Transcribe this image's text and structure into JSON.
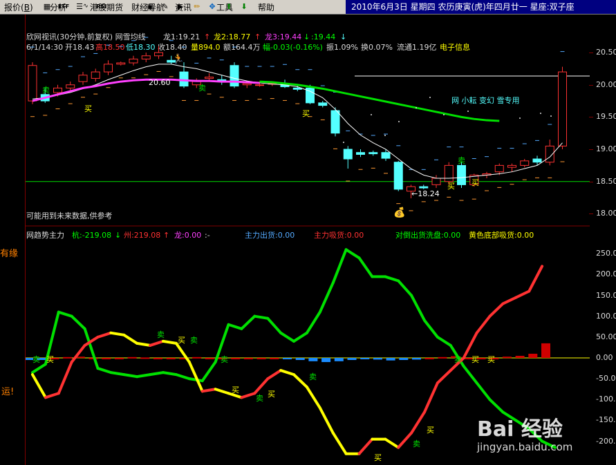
{
  "menu": {
    "items": [
      {
        "label": "报价",
        "key": "B"
      },
      {
        "label": "分析"
      },
      {
        "label": "港股期货"
      },
      {
        "label": "财经导航"
      },
      {
        "label": "资讯"
      },
      {
        "label": "工具"
      },
      {
        "label": "帮助"
      }
    ],
    "ind_labels": [
      "ETF",
      "RSI"
    ]
  },
  "date_info": "2010年6月3日  星期四  农历庚寅(虎)年四月廿一    星座:双子座",
  "left_labels": [
    "有缘",
    "运!"
  ],
  "top_panel": {
    "title": "欣网视讯(30分钟,前复权) 网雪均线",
    "long1": "龙1:19.21",
    "long2": "龙2:18.77",
    "long3": "龙3:19.44",
    "val4": ":19.44",
    "info": {
      "time": "6/1/14:30",
      "open": "开18.43",
      "high": "高18.50",
      "low": "低18.30",
      "close": "收18.40",
      "volume": "量894.0",
      "amount": "额164.4万",
      "change": "幅-0.03(-0.16%)",
      "amplitude": "振1.09%",
      "turnover": "换0.07%",
      "float": "流通1.19亿",
      "sector": "电子信息"
    },
    "annotation": "网 小耘 变幻 雪专用",
    "note": "可能用到未来数据,供参考",
    "max_label": "20.60",
    "min_label": "18.24",
    "sell_label": "卖",
    "buy_label": "买",
    "y_ticks": [
      "20.50",
      "20.00",
      "19.50",
      "19.00",
      "18.50",
      "18.00"
    ]
  },
  "bottom_panel": {
    "title": "网趋势主力",
    "hang": "杭:-219.08",
    "zhou": "州:219.08",
    "long": "龙:0.00",
    "main_out": "主力出货:0.00",
    "main_in": "主力吸货:0.00",
    "hedge": "对倒出货洗盘:0.00",
    "yellow": "黄色底部吸货:0.00",
    "y_ticks": [
      "250.00",
      "200.00",
      "150.00",
      "100.00",
      "50.00",
      "0.00",
      "-50.00",
      "-100.00",
      "-150.00",
      "-200.00"
    ]
  },
  "colors": {
    "up": "#ff3232",
    "down": "#54ffff",
    "green": "#00e000",
    "magenta": "#ff40ff",
    "yellow": "#ffff00",
    "axis": "#800000"
  },
  "watermark": {
    "brand": "Bai 经验",
    "url": "jingyan.baidu.com"
  },
  "chart_data": [
    {
      "type": "candlestick",
      "title": "欣网视讯(30分钟,前复权)",
      "ylim": [
        17.8,
        20.8
      ],
      "candles": [
        {
          "o": 19.75,
          "h": 20.35,
          "l": 19.7,
          "c": 20.3
        },
        {
          "o": 19.85,
          "h": 19.95,
          "l": 19.72,
          "c": 19.75
        },
        {
          "o": 19.88,
          "h": 20.0,
          "l": 19.82,
          "c": 19.95
        },
        {
          "o": 19.95,
          "h": 20.05,
          "l": 19.9,
          "c": 20.0
        },
        {
          "o": 20.05,
          "h": 20.2,
          "l": 20.0,
          "c": 20.15
        },
        {
          "o": 20.1,
          "h": 20.25,
          "l": 20.05,
          "c": 20.2
        },
        {
          "o": 20.2,
          "h": 20.38,
          "l": 20.15,
          "c": 20.32
        },
        {
          "o": 20.32,
          "h": 20.36,
          "l": 20.3,
          "c": 20.34
        },
        {
          "o": 20.34,
          "h": 20.45,
          "l": 20.3,
          "c": 20.4
        },
        {
          "o": 20.4,
          "h": 20.5,
          "l": 20.35,
          "c": 20.45
        },
        {
          "o": 20.45,
          "h": 20.6,
          "l": 20.4,
          "c": 20.5
        },
        {
          "o": 20.38,
          "h": 20.45,
          "l": 20.32,
          "c": 20.35
        },
        {
          "o": 20.2,
          "h": 20.35,
          "l": 19.95,
          "c": 19.98
        },
        {
          "o": 20.0,
          "h": 20.1,
          "l": 19.95,
          "c": 20.05
        },
        {
          "o": 20.1,
          "h": 20.18,
          "l": 20.05,
          "c": 20.12
        },
        {
          "o": 20.08,
          "h": 20.15,
          "l": 20.0,
          "c": 20.05
        },
        {
          "o": 20.3,
          "h": 20.35,
          "l": 19.95,
          "c": 19.98
        },
        {
          "o": 20.0,
          "h": 20.05,
          "l": 19.95,
          "c": 20.02
        },
        {
          "o": 20.0,
          "h": 20.05,
          "l": 19.97,
          "c": 20.0
        },
        {
          "o": 20.02,
          "h": 20.05,
          "l": 19.98,
          "c": 20.02
        },
        {
          "o": 20.02,
          "h": 20.08,
          "l": 19.95,
          "c": 19.97
        },
        {
          "o": 19.95,
          "h": 20.0,
          "l": 19.9,
          "c": 19.93
        },
        {
          "o": 19.95,
          "h": 20.0,
          "l": 19.7,
          "c": 19.72
        },
        {
          "o": 19.72,
          "h": 19.75,
          "l": 19.65,
          "c": 19.68
        },
        {
          "o": 19.6,
          "h": 19.65,
          "l": 19.2,
          "c": 19.25
        },
        {
          "o": 19.0,
          "h": 19.05,
          "l": 18.7,
          "c": 18.85
        },
        {
          "o": 18.95,
          "h": 19.0,
          "l": 18.88,
          "c": 18.92
        },
        {
          "o": 18.95,
          "h": 18.98,
          "l": 18.9,
          "c": 18.93
        },
        {
          "o": 18.95,
          "h": 19.0,
          "l": 18.82,
          "c": 18.86
        },
        {
          "o": 18.8,
          "h": 18.82,
          "l": 18.35,
          "c": 18.38
        },
        {
          "o": 18.35,
          "h": 18.45,
          "l": 18.24,
          "c": 18.42
        },
        {
          "o": 18.42,
          "h": 18.45,
          "l": 18.38,
          "c": 18.4
        },
        {
          "o": 18.45,
          "h": 18.6,
          "l": 18.4,
          "c": 18.55
        },
        {
          "o": 18.5,
          "h": 18.8,
          "l": 18.45,
          "c": 18.75
        },
        {
          "o": 18.75,
          "h": 18.8,
          "l": 18.4,
          "c": 18.45
        },
        {
          "o": 18.45,
          "h": 18.62,
          "l": 18.42,
          "c": 18.6
        },
        {
          "o": 18.6,
          "h": 18.65,
          "l": 18.55,
          "c": 18.62
        },
        {
          "o": 18.65,
          "h": 18.78,
          "l": 18.6,
          "c": 18.75
        },
        {
          "o": 18.72,
          "h": 18.78,
          "l": 18.65,
          "c": 18.75
        },
        {
          "o": 18.75,
          "h": 18.85,
          "l": 18.72,
          "c": 18.82
        },
        {
          "o": 18.85,
          "h": 18.9,
          "l": 18.75,
          "c": 18.8
        },
        {
          "o": 18.8,
          "h": 19.15,
          "l": 18.75,
          "c": 19.05
        },
        {
          "o": 19.05,
          "h": 20.28,
          "l": 19.0,
          "c": 20.2
        }
      ],
      "ma_white": [
        19.78,
        19.8,
        19.84,
        19.88,
        19.94,
        20.0,
        20.08,
        20.15,
        20.22,
        20.28,
        20.32,
        20.32,
        20.28,
        20.25,
        20.2,
        20.15,
        20.1,
        20.06,
        20.03,
        20.01,
        20.0,
        19.97,
        19.9,
        19.8,
        19.62,
        19.4,
        19.22,
        19.1,
        19.0,
        18.85,
        18.7,
        18.6,
        18.55,
        18.55,
        18.56,
        18.58,
        18.6,
        18.62,
        18.65,
        18.7,
        18.75,
        18.88,
        19.1
      ],
      "ma_magenta": [
        19.75,
        19.8,
        19.85,
        19.9,
        19.95,
        19.98,
        20.02,
        20.05,
        20.07,
        20.08,
        20.08,
        20.08,
        20.07,
        20.06,
        20.06,
        20.05,
        20.05,
        20.04,
        20.03
      ],
      "ma_green": [
        20.05,
        20.04,
        20.02,
        20.0,
        19.97,
        19.94,
        19.9,
        19.86,
        19.82,
        19.78,
        19.74,
        19.7,
        19.66,
        19.62,
        19.58,
        19.54,
        19.5,
        19.47,
        19.45,
        19.44
      ],
      "hline": 18.5
    },
    {
      "type": "line",
      "title": "网趋势主力",
      "ylim": [
        -215,
        270
      ],
      "series": [
        {
          "name": "杭",
          "values": [
            -35,
            -15,
            110,
            100,
            70,
            -25,
            -35,
            -40,
            -45,
            -40,
            -35,
            -40,
            -50,
            -55,
            -10,
            80,
            70,
            100,
            95,
            60,
            40,
            60,
            110,
            180,
            260,
            240,
            195,
            195,
            185,
            150,
            90,
            50,
            30,
            -20,
            -60,
            -100,
            -130,
            -150,
            -170,
            -200,
            -215
          ]
        },
        {
          "name": "州",
          "values": [
            -40,
            -95,
            -85,
            -10,
            30,
            50,
            60,
            55,
            35,
            30,
            40,
            35,
            -10,
            -80,
            -75,
            -85,
            -95,
            -85,
            -50,
            -30,
            -40,
            -70,
            -120,
            -180,
            -230,
            -230,
            -195,
            -195,
            -215,
            -180,
            -130,
            -60,
            -30,
            0,
            60,
            100,
            130,
            145,
            160,
            220
          ]
        }
      ],
      "histogram": [
        -5,
        -5,
        0,
        2,
        3,
        0,
        0,
        0,
        2,
        1,
        0,
        0,
        0,
        2,
        0,
        0,
        0,
        0,
        0,
        0,
        -3,
        -5,
        -8,
        -10,
        -8,
        -5,
        -3,
        -4,
        -6,
        -5,
        -4,
        0,
        2,
        4,
        0,
        0,
        0,
        3,
        5,
        10,
        35
      ]
    }
  ]
}
